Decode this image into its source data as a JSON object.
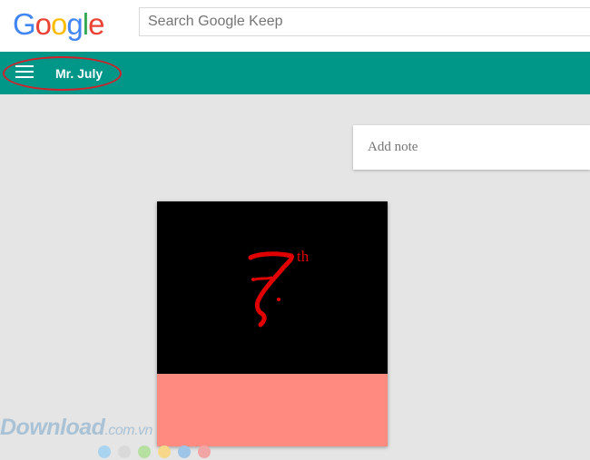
{
  "header": {
    "logo": {
      "letters": [
        {
          "char": "G",
          "color": "#4285F4"
        },
        {
          "char": "o",
          "color": "#EA4335"
        },
        {
          "char": "o",
          "color": "#FBBC05"
        },
        {
          "char": "g",
          "color": "#4285F4"
        },
        {
          "char": "l",
          "color": "#34A853"
        },
        {
          "char": "e",
          "color": "#EA4335"
        }
      ]
    },
    "search": {
      "placeholder": "Search Google Keep",
      "value": ""
    }
  },
  "appbar": {
    "color": "#009688",
    "menu_icon": "hamburger-menu-icon",
    "title": "Mr. July",
    "annotation_color": "#d4202b"
  },
  "main": {
    "add_note": {
      "placeholder": "Add note",
      "value": ""
    },
    "note": {
      "image_text": "7",
      "image_superscript": "th",
      "image_background": "#000000",
      "image_ink": "#e00000",
      "body_color": "#ff8a80"
    }
  },
  "watermark": {
    "brand": "Download",
    "domain": ".com.vn",
    "dot_colors": [
      "#a8d4f0",
      "#d9d9d9",
      "#b5e0a0",
      "#f7d78a",
      "#9ec4e6",
      "#f2a5a5"
    ]
  }
}
